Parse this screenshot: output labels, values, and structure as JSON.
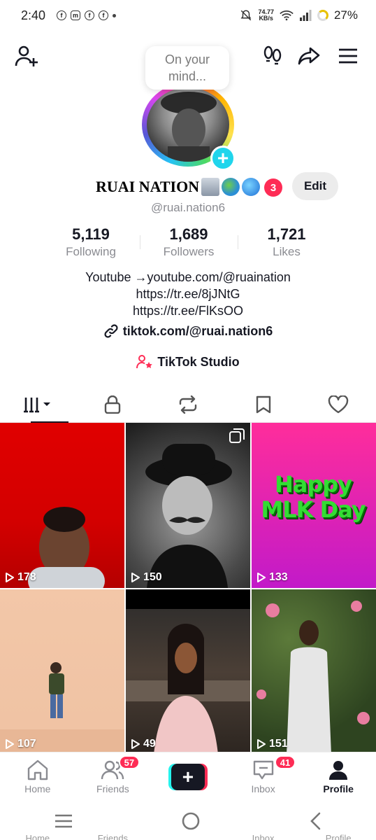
{
  "status_bar": {
    "time": "2:40",
    "net_speed_value": "74.77",
    "net_speed_unit": "KB/s",
    "battery": "27%"
  },
  "header": {
    "bubble_text": "On your mind..."
  },
  "profile": {
    "display_name": "RUAI NATION",
    "name_badge_count": "3",
    "edit_label": "Edit",
    "username": "@ruai.nation6",
    "stats": [
      {
        "value": "5,119",
        "label": "Following"
      },
      {
        "value": "1,689",
        "label": "Followers"
      },
      {
        "value": "1,721",
        "label": "Likes"
      }
    ],
    "bio_lines": [
      "Youtube →youtube.com/@ruaination",
      "https://tr.ee/8jJNtG",
      "https://tr.ee/FlKsOO"
    ],
    "link": "tiktok.com/@ruai.nation6",
    "studio_label": "TikTok Studio"
  },
  "tabs": [
    "videos",
    "private",
    "reposts",
    "favorites",
    "liked"
  ],
  "videos": [
    {
      "views": "178"
    },
    {
      "views": "150"
    },
    {
      "views": "133",
      "overlay_text": "Happy MLK Day"
    },
    {
      "views": "107"
    },
    {
      "views": "49"
    },
    {
      "views": "151"
    }
  ],
  "bottom_nav": {
    "home": "Home",
    "friends": "Friends",
    "friends_badge": "57",
    "inbox": "Inbox",
    "inbox_badge": "41",
    "profile": "Profile"
  },
  "ghost_labels": [
    "Home",
    "Friends",
    "",
    "Inbox",
    "Profile"
  ],
  "colors": {
    "accent": "#fe2c55",
    "cyan": "#25f4ee",
    "avatar_plus": "#20d5ec"
  }
}
